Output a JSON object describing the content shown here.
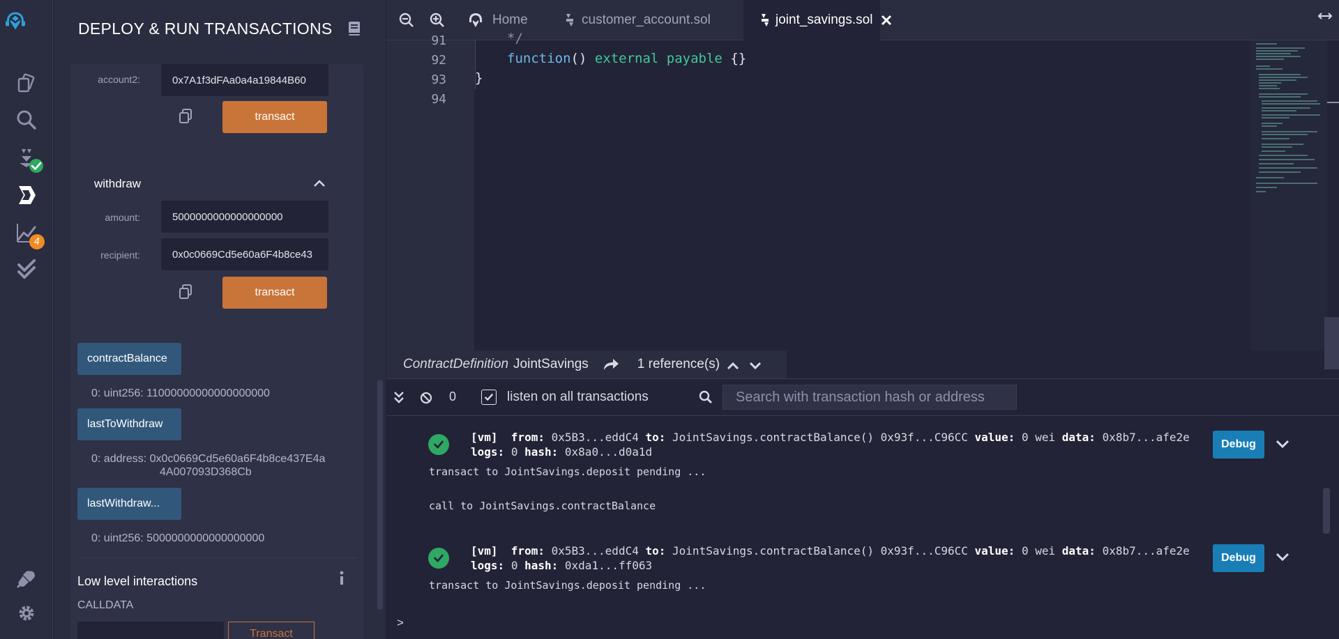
{
  "panel": {
    "title": "DEPLOY & RUN TRANSACTIONS"
  },
  "deposit_form": {
    "account2_label": "account2:",
    "account2_value": "0x7A1f3dFAa0a4a19844B60",
    "transact_label": "transact"
  },
  "withdraw_form": {
    "title": "withdraw",
    "amount_label": "amount:",
    "amount_value": "5000000000000000000",
    "recipient_label": "recipient:",
    "recipient_value": "0x0c0669Cd5e60a6F4b8ce43",
    "transact_label": "transact"
  },
  "calls": [
    {
      "label": "contractBalance",
      "result": "0: uint256: 11000000000000000000"
    },
    {
      "label": "lastToWithdraw",
      "result_line1": "0:  address: 0x0c0669Cd5e60a6F4b8ce437E4a",
      "result_line2": "4A007093D368Cb"
    },
    {
      "label": "lastWithdraw...",
      "result": "0: uint256: 5000000000000000000"
    }
  ],
  "low_level": {
    "title": "Low level interactions",
    "calldata_label": "CALLDATA",
    "transact_label": "Transact"
  },
  "tabs": [
    {
      "label": "Home"
    },
    {
      "label": "customer_account.sol"
    },
    {
      "label": "joint_savings.sol"
    }
  ],
  "editor": {
    "lines": [
      {
        "num": "91",
        "text": "*/"
      },
      {
        "num": "92",
        "kw1": "function",
        "mid": "() ",
        "kw2": "external payable",
        "tail": " {}"
      },
      {
        "num": "93",
        "text": "}"
      },
      {
        "num": "94",
        "text": ""
      }
    ]
  },
  "refbar": {
    "kind": "ContractDefinition",
    "name": "JointSavings",
    "references": "1 reference(s)"
  },
  "terminal": {
    "pending_count": "0",
    "listen_label": "listen on all transactions",
    "search_placeholder": "Search with transaction hash or address",
    "debug_label": "Debug",
    "entries": [
      {
        "vm": "[vm]",
        "from_label": "from:",
        "from": "0x5B3...eddC4",
        "to_label": "to:",
        "to": "JointSavings.contractBalance() 0x93f...C96CC",
        "value_label": "value:",
        "value": "0 wei",
        "data_label": "data:",
        "data": "0x8b7...afe2e",
        "logs_label": "logs:",
        "logs": "0",
        "hash_label": "hash:",
        "hash": "0x8a0...d0a1d"
      },
      {
        "vm": "[vm]",
        "from_label": "from:",
        "from": "0x5B3...eddC4",
        "to_label": "to:",
        "to": "JointSavings.contractBalance() 0x93f...C96CC",
        "value_label": "value:",
        "value": "0 wei",
        "data_label": "data:",
        "data": "0x8b7...afe2e",
        "logs_label": "logs:",
        "logs": "0",
        "hash_label": "hash:",
        "hash": "0xda1...ff063"
      }
    ],
    "msg_pending_1": "transact to JointSavings.deposit pending ...",
    "msg_call": "call to JointSavings.contractBalance",
    "msg_pending_2": "transact to JointSavings.deposit pending ...",
    "prompt": ">"
  },
  "rail": {
    "analysis_badge": "4",
    "icons": [
      "remix-logo-icon",
      "file-explorer-icon",
      "search-icon",
      "solidity-compiler-icon",
      "deploy-run-icon",
      "analysis-icon",
      "unit-testing-icon",
      "plugin-manager-icon",
      "settings-icon"
    ]
  },
  "colors": {
    "accent_orange": "#c97539",
    "call_button_blue": "#31587a",
    "debug_blue": "#1a7eb6",
    "success_green": "#2ea863",
    "badge_orange": "#f08a24"
  }
}
